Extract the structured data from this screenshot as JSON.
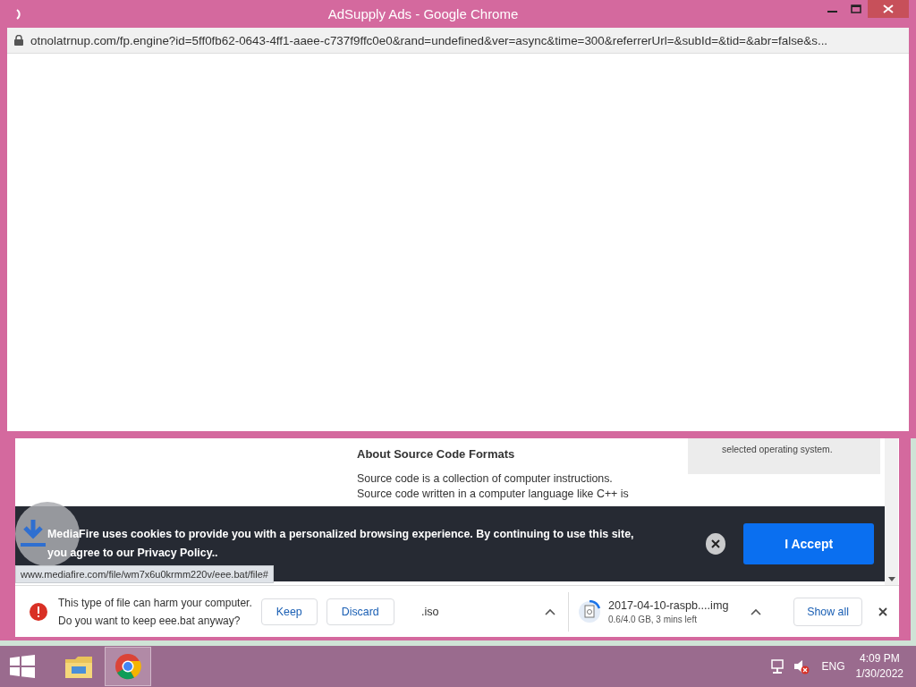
{
  "popup": {
    "title": "AdSupply Ads - Google Chrome",
    "url": "otnolatrnup.com/fp.engine?id=5ff0fb62-0643-4ff1-aaee-c737f9ffc0e0&rand=undefined&ver=async&time=300&referrerUrl=&subId=&tid=&abr=false&s..."
  },
  "page": {
    "heading": "About Source Code Formats",
    "paragraph_lines": [
      "Source code is a collection of computer instructions.",
      "Source code written in a computer language like C++ is"
    ],
    "sidebar_text": "selected operating system."
  },
  "cookie_banner": {
    "text": "MediaFire uses cookies to provide you with a personalized browsing experience. By continuing to use this site, you agree to our Privacy Policy..",
    "accept": "I Accept"
  },
  "status_url": "www.mediafire.com/file/wm7x6u0krmm220v/eee.bat/file#",
  "download_shelf": {
    "warning": {
      "lines": [
        "This type of file can harm your computer.",
        "Do you want to keep eee.bat anyway?"
      ],
      "buttons": [
        "Keep",
        "Discard"
      ]
    },
    "items": [
      {
        "kind": "partial",
        "name": ".iso"
      },
      {
        "kind": "progress",
        "name": "2017-04-10-raspb....img",
        "status": "0.6/4.0 GB, 3 mins left"
      }
    ],
    "show_all": "Show all"
  },
  "taskbar": {
    "language": "ENG",
    "time": "4:09 PM",
    "date": "1/30/2022"
  }
}
